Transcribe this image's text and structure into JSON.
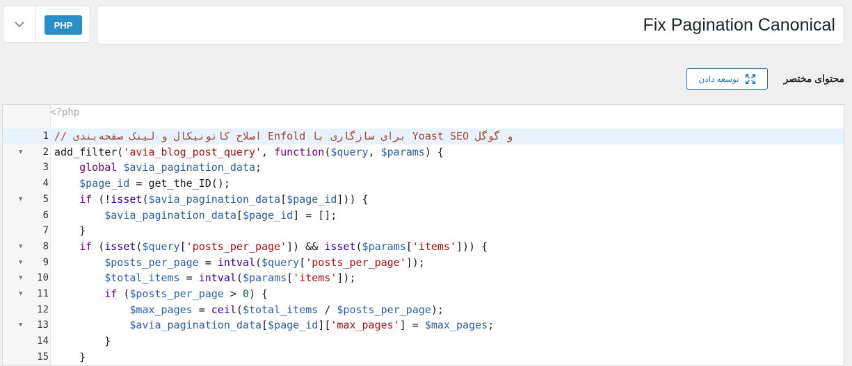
{
  "type_selector": {
    "badge": "PHP",
    "dropdown_icon": "chevron-down-icon"
  },
  "title": {
    "value": "Fix Pagination Canonical"
  },
  "section": {
    "label": "محتوای مختصر",
    "expand_label": "توسعه دادن",
    "expand_icon": "expand-arrows-icon"
  },
  "editor": {
    "header": "<?php",
    "lines": [
      {
        "n": "1",
        "fold": false,
        "active": true
      },
      {
        "n": "2",
        "fold": true
      },
      {
        "n": "3",
        "fold": false
      },
      {
        "n": "4",
        "fold": false
      },
      {
        "n": "5",
        "fold": true
      },
      {
        "n": "6",
        "fold": false
      },
      {
        "n": "7",
        "fold": false
      },
      {
        "n": "8",
        "fold": true
      },
      {
        "n": "9",
        "fold": true
      },
      {
        "n": "10",
        "fold": true
      },
      {
        "n": "11",
        "fold": true
      },
      {
        "n": "12",
        "fold": false
      },
      {
        "n": "13",
        "fold": true
      },
      {
        "n": "14",
        "fold": false
      },
      {
        "n": "15",
        "fold": false
      }
    ],
    "code": [
      [
        {
          "c": "tk-comment",
          "t": "// اصلاح کانونیکال و لینک صفحه‌بندی Enfold برای سازگاری با Yoast SEO و گوگل"
        }
      ],
      [
        {
          "c": "",
          "t": "add_filter("
        },
        {
          "c": "tk-str",
          "t": "'avia_blog_post_query'"
        },
        {
          "c": "",
          "t": ", "
        },
        {
          "c": "tk-kw",
          "t": "function"
        },
        {
          "c": "",
          "t": "("
        },
        {
          "c": "tk-var",
          "t": "$query"
        },
        {
          "c": "",
          "t": ", "
        },
        {
          "c": "tk-var",
          "t": "$params"
        },
        {
          "c": "",
          "t": ") {"
        }
      ],
      [
        {
          "c": "",
          "t": "    "
        },
        {
          "c": "tk-kw",
          "t": "global"
        },
        {
          "c": "",
          "t": " "
        },
        {
          "c": "tk-var",
          "t": "$avia_pagination_data"
        },
        {
          "c": "",
          "t": ";"
        }
      ],
      [
        {
          "c": "",
          "t": "    "
        },
        {
          "c": "tk-var",
          "t": "$page_id"
        },
        {
          "c": "",
          "t": " = get_the_ID();"
        }
      ],
      [
        {
          "c": "",
          "t": "    "
        },
        {
          "c": "tk-kw",
          "t": "if"
        },
        {
          "c": "",
          "t": " (!"
        },
        {
          "c": "tk-fn",
          "t": "isset"
        },
        {
          "c": "",
          "t": "("
        },
        {
          "c": "tk-var",
          "t": "$avia_pagination_data"
        },
        {
          "c": "",
          "t": "["
        },
        {
          "c": "tk-var",
          "t": "$page_id"
        },
        {
          "c": "",
          "t": "])) {"
        }
      ],
      [
        {
          "c": "",
          "t": "        "
        },
        {
          "c": "tk-var",
          "t": "$avia_pagination_data"
        },
        {
          "c": "",
          "t": "["
        },
        {
          "c": "tk-var",
          "t": "$page_id"
        },
        {
          "c": "",
          "t": "] = [];"
        }
      ],
      [
        {
          "c": "",
          "t": "    }"
        }
      ],
      [
        {
          "c": "",
          "t": "    "
        },
        {
          "c": "tk-kw",
          "t": "if"
        },
        {
          "c": "",
          "t": " ("
        },
        {
          "c": "tk-fn",
          "t": "isset"
        },
        {
          "c": "",
          "t": "("
        },
        {
          "c": "tk-var",
          "t": "$query"
        },
        {
          "c": "",
          "t": "["
        },
        {
          "c": "tk-str",
          "t": "'posts_per_page'"
        },
        {
          "c": "",
          "t": "]) && "
        },
        {
          "c": "tk-fn",
          "t": "isset"
        },
        {
          "c": "",
          "t": "("
        },
        {
          "c": "tk-var",
          "t": "$params"
        },
        {
          "c": "",
          "t": "["
        },
        {
          "c": "tk-str",
          "t": "'items'"
        },
        {
          "c": "",
          "t": "])) {"
        }
      ],
      [
        {
          "c": "",
          "t": "        "
        },
        {
          "c": "tk-var",
          "t": "$posts_per_page"
        },
        {
          "c": "",
          "t": " = "
        },
        {
          "c": "tk-fn",
          "t": "intval"
        },
        {
          "c": "",
          "t": "("
        },
        {
          "c": "tk-var",
          "t": "$query"
        },
        {
          "c": "",
          "t": "["
        },
        {
          "c": "tk-str",
          "t": "'posts_per_page'"
        },
        {
          "c": "",
          "t": "]);"
        }
      ],
      [
        {
          "c": "",
          "t": "        "
        },
        {
          "c": "tk-var",
          "t": "$total_items"
        },
        {
          "c": "",
          "t": " = "
        },
        {
          "c": "tk-fn",
          "t": "intval"
        },
        {
          "c": "",
          "t": "("
        },
        {
          "c": "tk-var",
          "t": "$params"
        },
        {
          "c": "",
          "t": "["
        },
        {
          "c": "tk-str",
          "t": "'items'"
        },
        {
          "c": "",
          "t": "]);"
        }
      ],
      [
        {
          "c": "",
          "t": "        "
        },
        {
          "c": "tk-kw",
          "t": "if"
        },
        {
          "c": "",
          "t": " ("
        },
        {
          "c": "tk-var",
          "t": "$posts_per_page"
        },
        {
          "c": "",
          "t": " > "
        },
        {
          "c": "tk-num",
          "t": "0"
        },
        {
          "c": "",
          "t": ") {"
        }
      ],
      [
        {
          "c": "",
          "t": "            "
        },
        {
          "c": "tk-var",
          "t": "$max_pages"
        },
        {
          "c": "",
          "t": " = "
        },
        {
          "c": "tk-fn",
          "t": "ceil"
        },
        {
          "c": "",
          "t": "("
        },
        {
          "c": "tk-var",
          "t": "$total_items"
        },
        {
          "c": "",
          "t": " / "
        },
        {
          "c": "tk-var",
          "t": "$posts_per_page"
        },
        {
          "c": "",
          "t": ");"
        }
      ],
      [
        {
          "c": "",
          "t": "            "
        },
        {
          "c": "tk-var",
          "t": "$avia_pagination_data"
        },
        {
          "c": "",
          "t": "["
        },
        {
          "c": "tk-var",
          "t": "$page_id"
        },
        {
          "c": "",
          "t": "]["
        },
        {
          "c": "tk-str",
          "t": "'max_pages'"
        },
        {
          "c": "",
          "t": "] = "
        },
        {
          "c": "tk-var",
          "t": "$max_pages"
        },
        {
          "c": "",
          "t": ";"
        }
      ],
      [
        {
          "c": "",
          "t": "        }"
        }
      ],
      [
        {
          "c": "",
          "t": "    }"
        }
      ]
    ]
  }
}
